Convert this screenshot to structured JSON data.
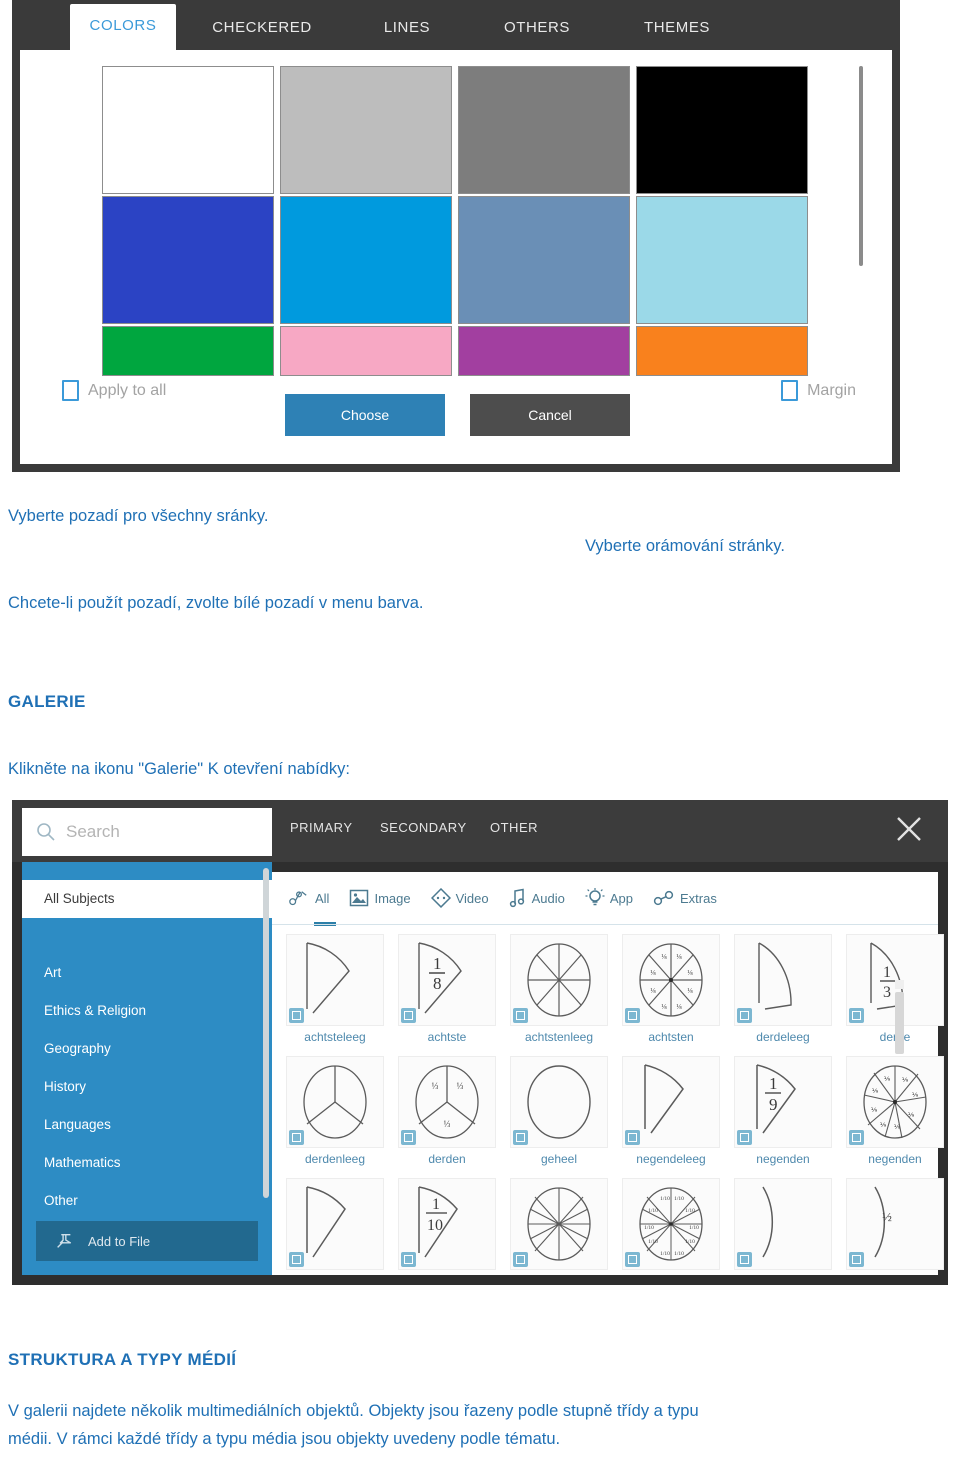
{
  "colors_dialog": {
    "tabs": [
      {
        "label": "COLORS",
        "active": true
      },
      {
        "label": "CHECKERED",
        "active": false
      },
      {
        "label": "LINES",
        "active": false
      },
      {
        "label": "OTHERS",
        "active": false
      },
      {
        "label": "THEMES",
        "active": false
      }
    ],
    "swatches": [
      {
        "name": "white",
        "color": "#ffffff"
      },
      {
        "name": "light-gray",
        "color": "#bdbdbd"
      },
      {
        "name": "gray",
        "color": "#7d7d7d"
      },
      {
        "name": "black",
        "color": "#000000"
      },
      {
        "name": "blue",
        "color": "#2b43c4"
      },
      {
        "name": "azure",
        "color": "#009ade"
      },
      {
        "name": "steel-blue",
        "color": "#6a8fb6"
      },
      {
        "name": "pale-blue",
        "color": "#9bd9e8"
      },
      {
        "name": "green",
        "color": "#00a63f"
      },
      {
        "name": "pink",
        "color": "#f7a8c4"
      },
      {
        "name": "purple",
        "color": "#a23fa0"
      },
      {
        "name": "orange",
        "color": "#f9811d"
      }
    ],
    "apply_to_all_label": "Apply to all",
    "margin_label": "Margin",
    "choose_label": "Choose",
    "cancel_label": "Cancel",
    "accent_color": "#3b9ad9",
    "choose_button_color": "#2e81b5",
    "cancel_button_color": "#4d4d4d"
  },
  "text": {
    "line_background": "Vyberte pozadí pro všechny sránky.",
    "line_border": "Vyberte orámování stránky.",
    "line_hint": "Chcete-li použít  pozadí, zvolte bílé pozadí v menu barva.",
    "heading_gallery": "GALERIE",
    "line_gallery_intro": "Klikněte na ikonu \"Galerie\" K otevření nabídky:",
    "heading_structure": "STRUKTURA A TYPY MÉDIÍ",
    "paragraph_structure_1": "V galerii najdete několik multimediálních objektů. Objekty jsou řazeny podle stupně třídy a typu",
    "paragraph_structure_2": "médii. V rámci každé třídy a typu média jsou objekty uvedeny podle tématu.",
    "body_color": "#1f70b5"
  },
  "gallery": {
    "search_placeholder": "Search",
    "categories": [
      "PRIMARY",
      "SECONDARY",
      "OTHER"
    ],
    "close_label": "×",
    "sidebar": {
      "items": [
        {
          "label": "All Subjects",
          "selected": true
        },
        {
          "label": "Art",
          "selected": false
        },
        {
          "label": "Ethics & Religion",
          "selected": false
        },
        {
          "label": "Geography",
          "selected": false
        },
        {
          "label": "History",
          "selected": false
        },
        {
          "label": "Languages",
          "selected": false
        },
        {
          "label": "Mathematics",
          "selected": false
        }
      ],
      "other_label": "Other",
      "add_to_file_label": "Add to File",
      "background_color": "#2d8cc4"
    },
    "media_filters": [
      {
        "label": "All",
        "icon": "all-media-icon",
        "active": true
      },
      {
        "label": "Image",
        "icon": "image-icon",
        "active": false
      },
      {
        "label": "Video",
        "icon": "video-icon",
        "active": false
      },
      {
        "label": "Audio",
        "icon": "audio-icon",
        "active": false
      },
      {
        "label": "App",
        "icon": "app-bulb-icon",
        "active": false
      },
      {
        "label": "Extras",
        "icon": "extras-link-icon",
        "active": false
      }
    ],
    "tiles_row1": [
      {
        "label": "achtsteleeg",
        "shape": "sector-empty",
        "fraction": ""
      },
      {
        "label": "achtste",
        "shape": "sector-labeled",
        "fraction": "1/8"
      },
      {
        "label": "achtstenleeg",
        "shape": "pie-8-empty",
        "fraction": ""
      },
      {
        "label": "achtsten",
        "shape": "pie-8-labeled",
        "fraction": "1/8"
      },
      {
        "label": "derdeleeg",
        "shape": "sector-empty",
        "fraction": ""
      },
      {
        "label": "derde",
        "shape": "sector-labeled",
        "fraction": "1/3"
      }
    ],
    "tiles_row2": [
      {
        "label": "derdenleeg",
        "shape": "pie-3-empty",
        "fraction": ""
      },
      {
        "label": "derden",
        "shape": "pie-3-labeled",
        "fraction": "1/3"
      },
      {
        "label": "geheel",
        "shape": "whole-circle",
        "fraction": ""
      },
      {
        "label": "negendeleeg",
        "shape": "sector-empty",
        "fraction": ""
      },
      {
        "label": "negenden",
        "shape": "sector-labeled",
        "fraction": "1/9"
      },
      {
        "label": "negenden",
        "shape": "pie-9-labeled",
        "fraction": "1/9"
      }
    ],
    "tiles_row3": [
      {
        "label": "",
        "shape": "sector-empty",
        "fraction": ""
      },
      {
        "label": "",
        "shape": "sector-labeled",
        "fraction": "1/10"
      },
      {
        "label": "",
        "shape": "pie-10-empty",
        "fraction": ""
      },
      {
        "label": "",
        "shape": "pie-10-labeled",
        "fraction": "1/10"
      },
      {
        "label": "",
        "shape": "sector-empty",
        "fraction": ""
      },
      {
        "label": "",
        "shape": "sector-labeled",
        "fraction": "1/2"
      }
    ],
    "accent_color": "#2d8cc4",
    "label_color": "#4e89ad"
  }
}
